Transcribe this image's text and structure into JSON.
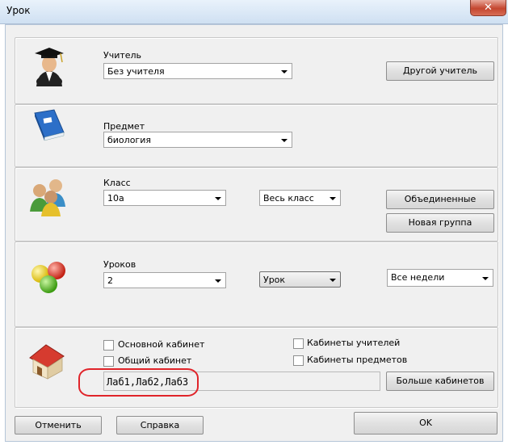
{
  "window": {
    "title": "Урок",
    "close_glyph": "✕"
  },
  "teacher": {
    "label": "Учитель",
    "selected": "Без учителя",
    "other_button": "Другой учитель",
    "icon": "teacher-graduate-icon"
  },
  "subject": {
    "label": "Предмет",
    "selected": "биология",
    "icon": "book-icon"
  },
  "class": {
    "label": "Класс",
    "selected": "10а",
    "group_selected": "Весь класс",
    "combined_button": "Объединенные",
    "new_group_button": "Новая группа",
    "icon": "people-group-icon"
  },
  "lessons": {
    "label": "Уроков",
    "count_selected": "2",
    "type_selected": "Урок",
    "weeks_selected": "Все недели",
    "icon": "colored-balls-icon"
  },
  "rooms": {
    "main_room": "Основной кабинет",
    "shared_room": "Общий кабинет",
    "teachers_rooms": "Кабинеты учителей",
    "subject_rooms": "Кабинеты предметов",
    "selected_rooms": "Лаб1,Лаб2,Лаб3",
    "more_button": "Больше кабинетов",
    "icon": "house-icon"
  },
  "footer": {
    "cancel": "Отменить",
    "help": "Справка",
    "ok": "OK"
  },
  "colors": {
    "annotation": "#e0242a",
    "book": "#2c6fc8",
    "roof": "#d63b2f"
  }
}
